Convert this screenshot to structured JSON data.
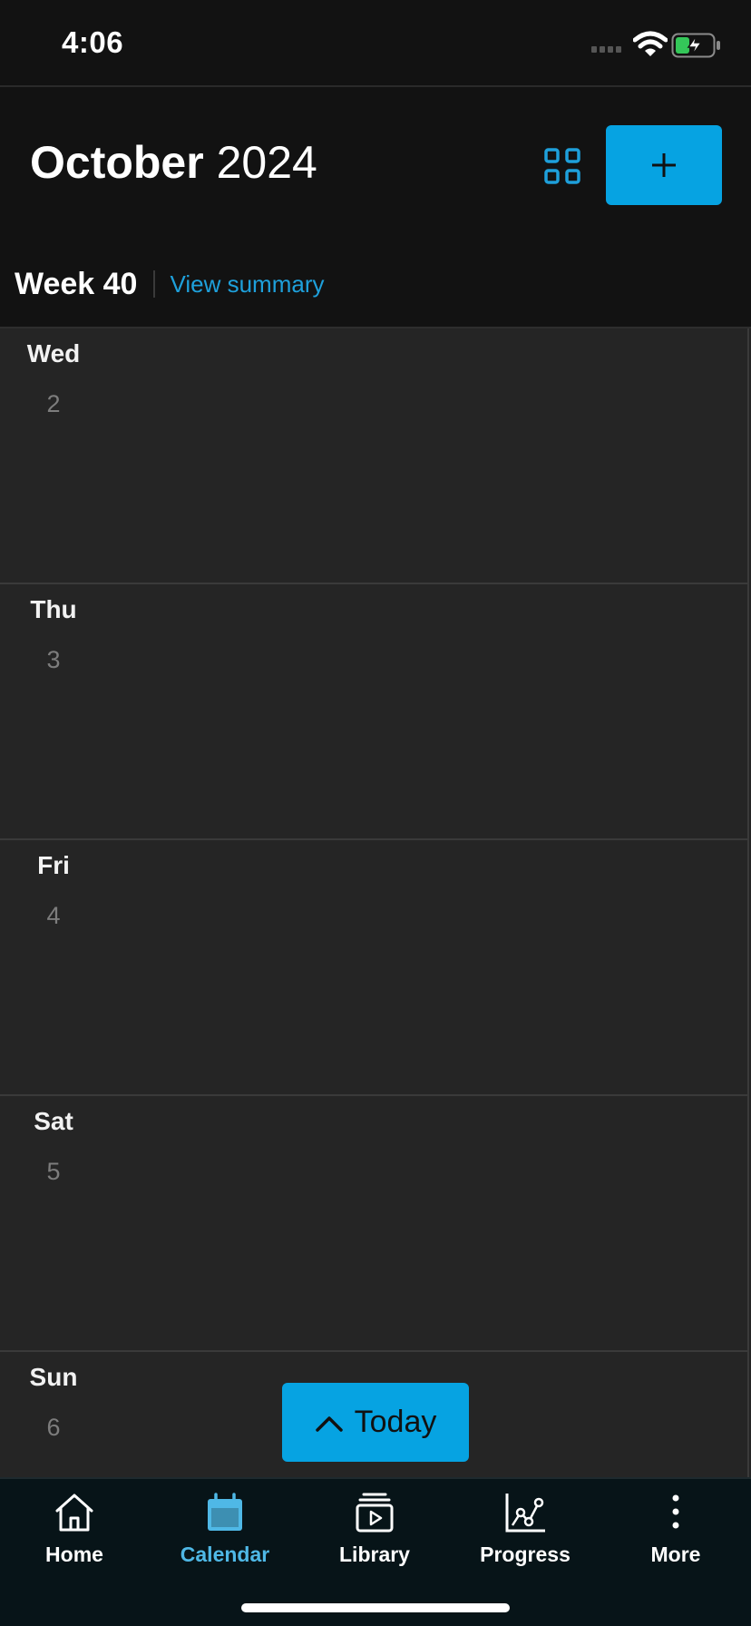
{
  "status": {
    "time": "4:06"
  },
  "header": {
    "month": "October",
    "year": "2024",
    "week_label": "Week 40",
    "view_summary": "View summary"
  },
  "days": [
    {
      "name": "Wed",
      "num": "2"
    },
    {
      "name": "Thu",
      "num": "3"
    },
    {
      "name": "Fri",
      "num": "4"
    },
    {
      "name": "Sat",
      "num": "5"
    },
    {
      "name": "Sun",
      "num": "6"
    }
  ],
  "today_button": {
    "label": "Today"
  },
  "tabs": [
    {
      "label": "Home",
      "icon": "home-icon"
    },
    {
      "label": "Calendar",
      "icon": "calendar-icon",
      "active": true
    },
    {
      "label": "Library",
      "icon": "library-icon"
    },
    {
      "label": "Progress",
      "icon": "progress-icon"
    },
    {
      "label": "More",
      "icon": "more-icon"
    }
  ],
  "colors": {
    "accent": "#06a3e2",
    "link": "#1ea0db",
    "active_tab": "#4fb8e6",
    "background": "#121212",
    "day_background": "#252525",
    "tabbar_background": "#071418"
  }
}
